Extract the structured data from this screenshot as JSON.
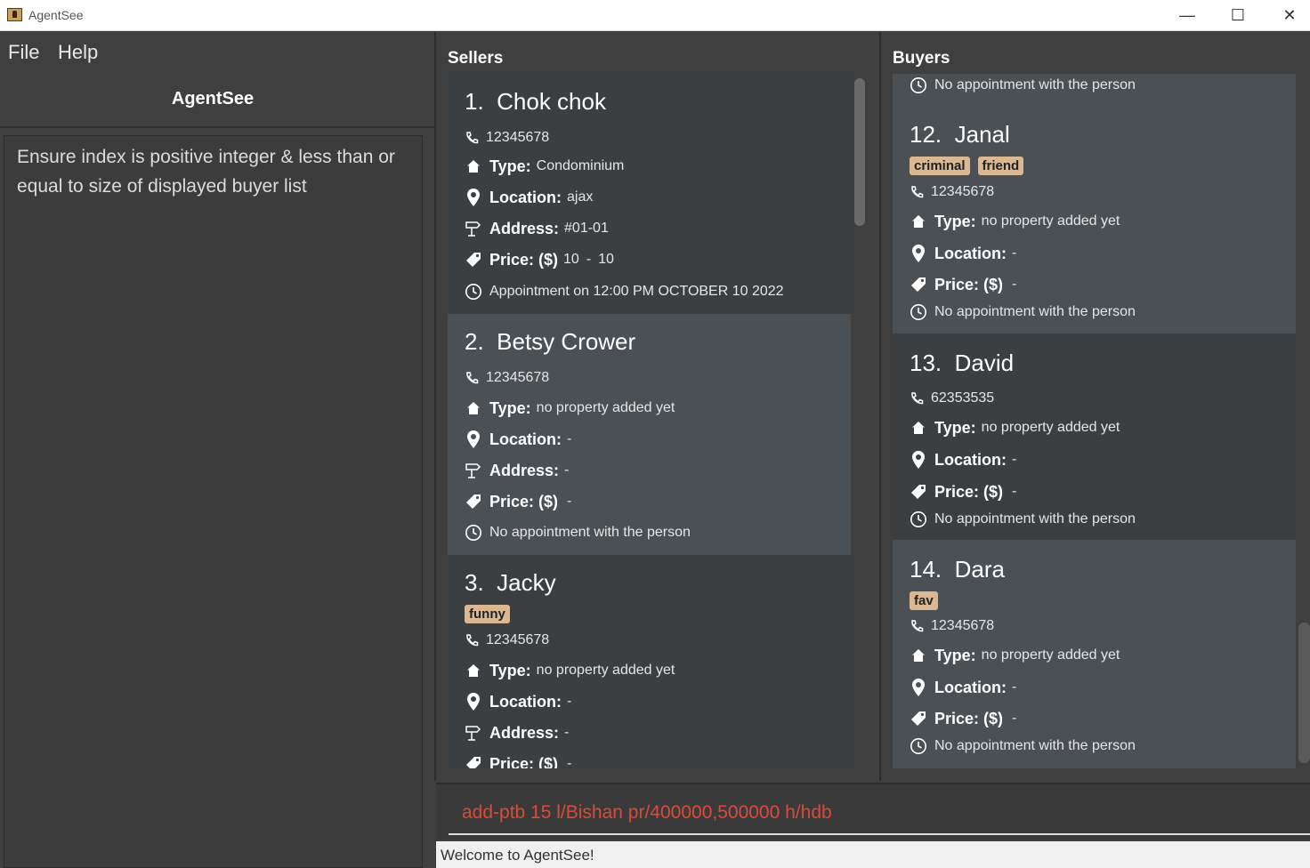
{
  "window": {
    "title": "AgentSee",
    "minimize": "—",
    "maximize": "☐",
    "close": "✕"
  },
  "menu": {
    "file": "File",
    "help": "Help"
  },
  "app_name": "AgentSee",
  "result_message": "Ensure index is positive integer & less than or equal to size of displayed buyer list",
  "sellers": {
    "title": "Sellers",
    "cards": [
      {
        "index": "1.",
        "name": "Chok chok",
        "phone": "12345678",
        "type": "Condominium",
        "location": "ajax",
        "address": "#01-01",
        "price_low": "10",
        "price_high": "10",
        "appointment": "Appointment on 12:00 PM OCTOBER 10 2022"
      },
      {
        "index": "2.",
        "name": "Betsy Crower",
        "phone": "12345678",
        "type": "no property added yet",
        "location": "-",
        "address": "-",
        "price": "-",
        "appointment": "No appointment with the person"
      },
      {
        "index": "3.",
        "name": "Jacky",
        "tags": [
          "funny"
        ],
        "phone": "12345678",
        "type": "no property added yet",
        "location": "-",
        "address": "-",
        "price": "-"
      }
    ]
  },
  "buyers": {
    "title": "Buyers",
    "partial_appointment": "No appointment with the person",
    "cards": [
      {
        "index": "12.",
        "name": "Janal",
        "tags": [
          "criminal",
          "friend"
        ],
        "phone": "12345678",
        "type": "no property added yet",
        "location": "-",
        "price": "-",
        "appointment": "No appointment with the person"
      },
      {
        "index": "13.",
        "name": "David",
        "phone": "62353535",
        "type": "no property added yet",
        "location": "-",
        "price": "-",
        "appointment": "No appointment with the person"
      },
      {
        "index": "14.",
        "name": "Dara",
        "tags": [
          "fav"
        ],
        "phone": "12345678",
        "type": "no property added yet",
        "location": "-",
        "price": "-",
        "appointment": "No appointment with the person"
      }
    ]
  },
  "labels": {
    "type": "Type:",
    "location": "Location:",
    "address": "Address:",
    "price": "Price: ($)"
  },
  "command": {
    "value": "add-ptb 15 l/Bishan pr/400000,500000 h/hdb"
  },
  "status": "Welcome to AgentSee!",
  "colors": {
    "card_dark": "#3c3f41",
    "card_light": "#4b5055",
    "tag": "#d9b892",
    "command_text": "#d94b3a"
  }
}
